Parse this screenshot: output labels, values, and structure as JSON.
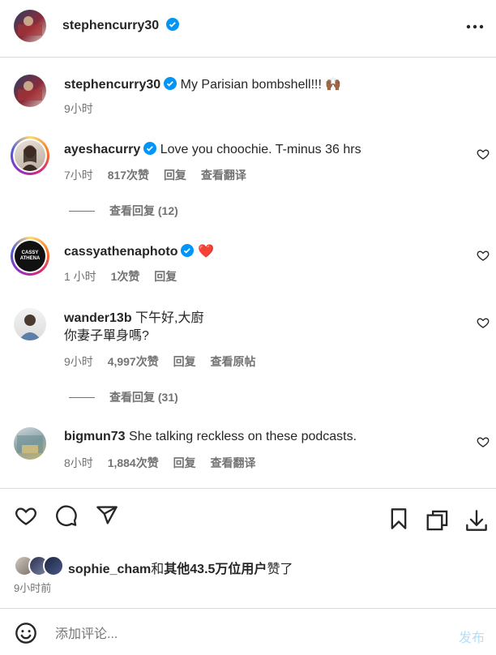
{
  "header": {
    "username": "stephencurry30",
    "more_icon": "more-horizontal-icon"
  },
  "caption": {
    "username": "stephencurry30",
    "text": "My Parisian bombshell!!! 🙌🏾",
    "time": "9小时"
  },
  "comments": [
    {
      "username": "ayeshacurry",
      "verified": true,
      "text": "Love you choochie. T-minus 36 hrs",
      "time": "7小时",
      "likes": "817次赞",
      "reply": "回复",
      "extra": "查看翻译",
      "view_replies": "查看回复 (12)"
    },
    {
      "username": "cassyathenaphoto",
      "verified": true,
      "text": "❤️",
      "time": "1 小时",
      "likes": "1次赞",
      "reply": "回复"
    },
    {
      "username": "wander13b",
      "verified": false,
      "text_line1": "下午好,大廚",
      "text_line2": "你妻子單身嗎?",
      "time": "9小时",
      "likes": "4,997次赞",
      "reply": "回复",
      "extra": "查看原帖",
      "view_replies": "查看回复 (31)"
    },
    {
      "username": "bigmun73",
      "verified": false,
      "text": "She talking reckless on these podcasts.",
      "time": "8小时",
      "likes": "1,884次赞",
      "reply": "回复",
      "extra": "查看翻译"
    }
  ],
  "likes_summary": {
    "user": "sophie_cham",
    "mid": "和",
    "others": "其他43.5万位用户",
    "suffix": "赞了"
  },
  "post_time": "9小时前",
  "composer": {
    "placeholder": "添加评论...",
    "post_label": "发布"
  },
  "avatar_text": {
    "cassy": "CASSY ATHENA"
  }
}
